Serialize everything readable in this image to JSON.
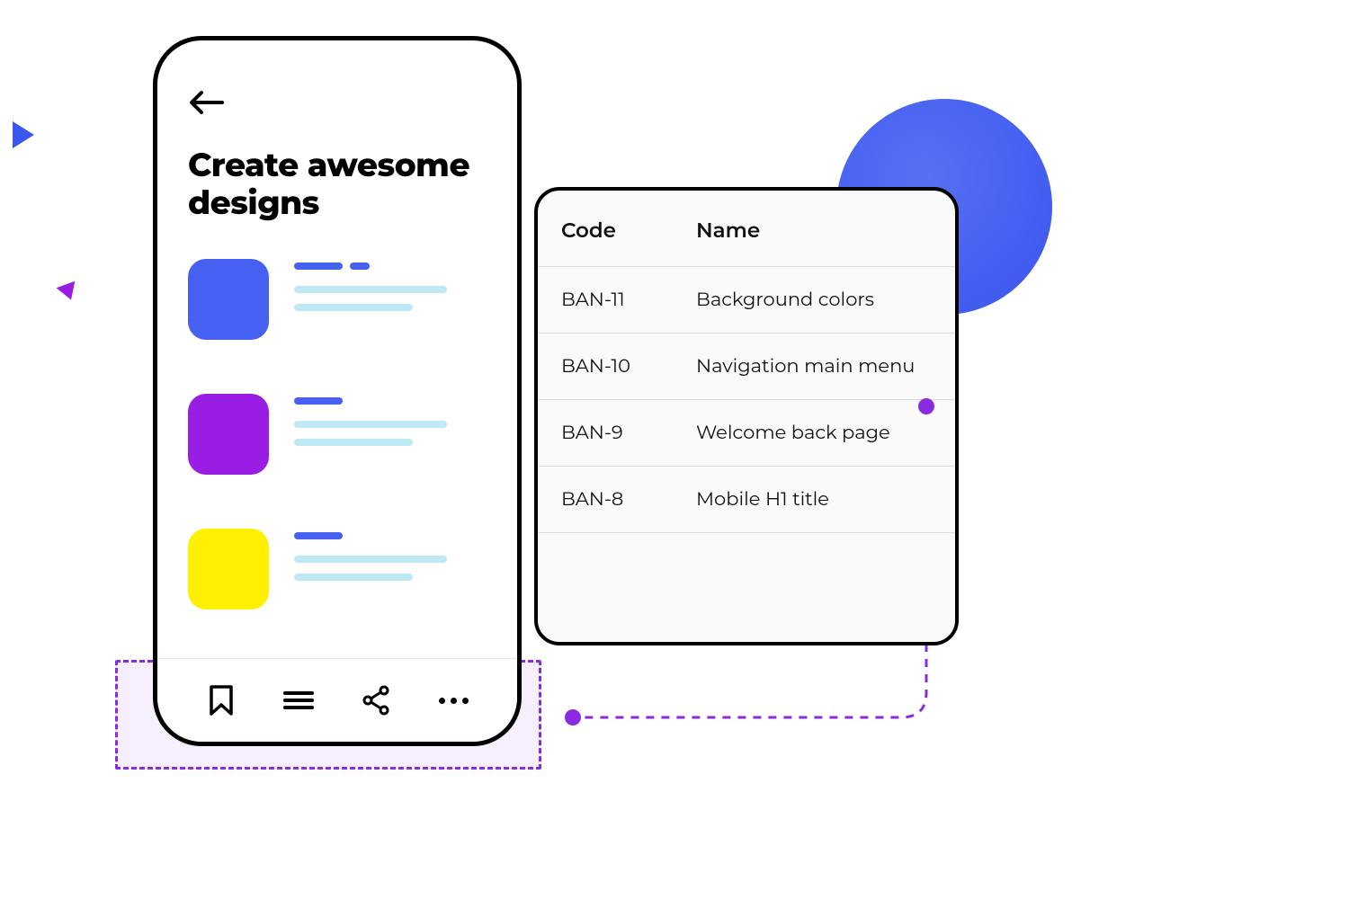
{
  "phone": {
    "heading": "Create awesome designs",
    "cards": [
      {
        "color": "#4661f1"
      },
      {
        "color": "#9a1de3"
      },
      {
        "color": "#fff000"
      }
    ],
    "nav_icons": [
      "bookmark",
      "menu",
      "share",
      "more"
    ]
  },
  "table": {
    "headers": {
      "code": "Code",
      "name": "Name"
    },
    "rows": [
      {
        "code": "BAN-11",
        "name": "Background colors"
      },
      {
        "code": "BAN-10",
        "name": "Navigation main menu"
      },
      {
        "code": "BAN-9",
        "name": "Welcome back page"
      },
      {
        "code": "BAN-8",
        "name": "Mobile H1 title"
      }
    ]
  },
  "colors": {
    "accent_blue": "#4661f1",
    "accent_purple": "#9a1de3",
    "accent_yellow": "#fff000",
    "highlight_purple": "#8a2be2",
    "line_cyan": "#bfe8f5"
  }
}
